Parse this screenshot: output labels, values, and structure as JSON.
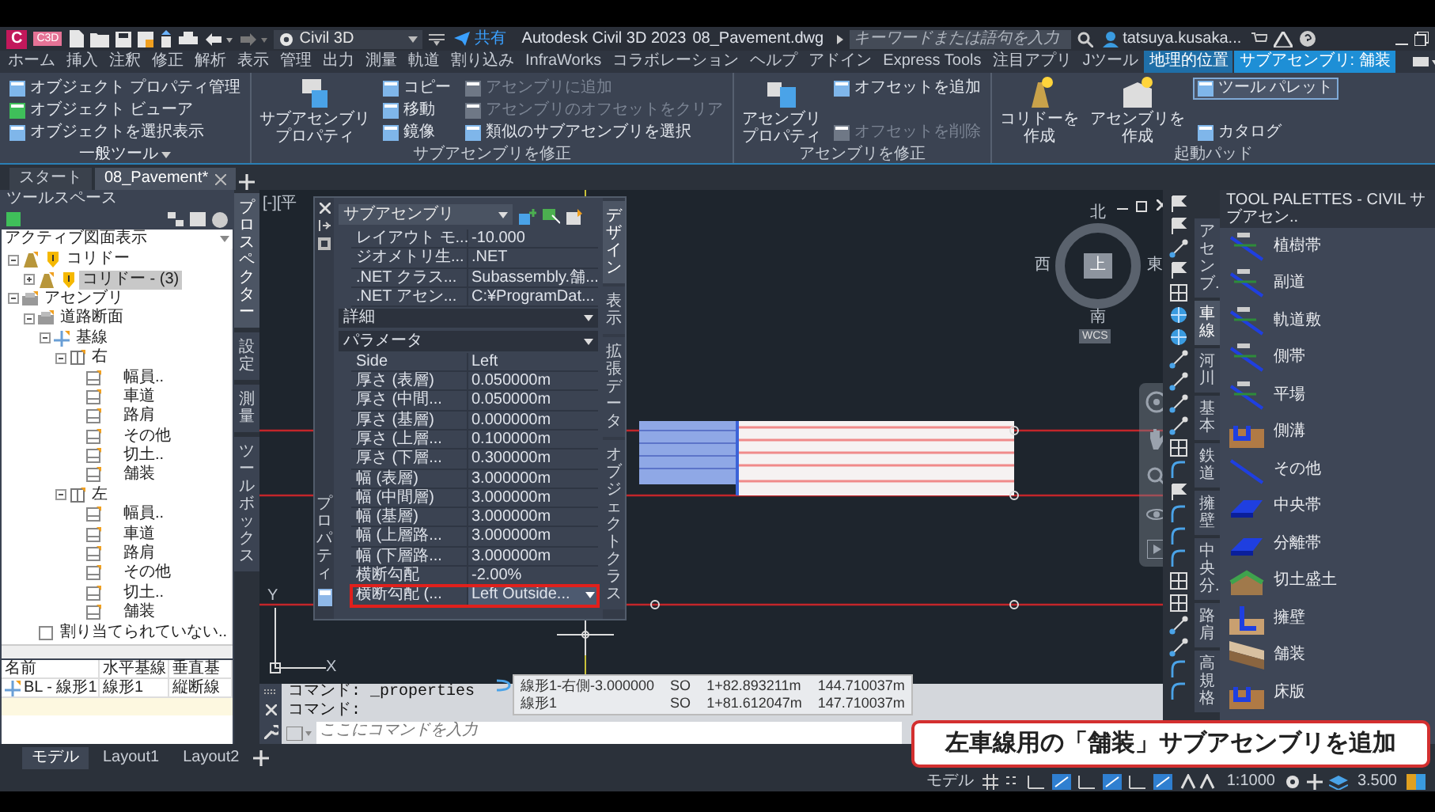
{
  "title_bar": {
    "logo": "C",
    "badge": "C3D",
    "workspace": "Civil 3D",
    "share": "共有",
    "app_title": "Autodesk Civil 3D 2023",
    "file_name": "08_Pavement.dwg",
    "search": {
      "placeholder": "キーワードまたは語句を入力"
    },
    "user": "tatsuya.kusaka..."
  },
  "menu_tabs": [
    {
      "label": "ホーム",
      "selected": false,
      "contextual": false
    },
    {
      "label": "挿入",
      "selected": false,
      "contextual": false
    },
    {
      "label": "注釈",
      "selected": false,
      "contextual": false
    },
    {
      "label": "修正",
      "selected": false,
      "contextual": false
    },
    {
      "label": "解析",
      "selected": false,
      "contextual": false
    },
    {
      "label": "表示",
      "selected": false,
      "contextual": false
    },
    {
      "label": "管理",
      "selected": false,
      "contextual": false
    },
    {
      "label": "出力",
      "selected": false,
      "contextual": false
    },
    {
      "label": "測量",
      "selected": false,
      "contextual": false
    },
    {
      "label": "軌道",
      "selected": false,
      "contextual": false
    },
    {
      "label": "割り込み",
      "selected": false,
      "contextual": false
    },
    {
      "label": "InfraWorks",
      "selected": false,
      "contextual": false
    },
    {
      "label": "コラボレーション",
      "selected": false,
      "contextual": false
    },
    {
      "label": "ヘルプ",
      "selected": false,
      "contextual": false
    },
    {
      "label": "アドイン",
      "selected": false,
      "contextual": false
    },
    {
      "label": "Express Tools",
      "selected": false,
      "contextual": false
    },
    {
      "label": "注目アプリ",
      "selected": false,
      "contextual": false
    },
    {
      "label": "Jツール",
      "selected": false,
      "contextual": false
    },
    {
      "label": "地理的位置",
      "selected": false,
      "contextual": true
    },
    {
      "label": "サブアセンブリ: 舗装",
      "selected": true,
      "contextual": true
    }
  ],
  "ribbon": [
    {
      "title": "一般ツール",
      "has_menu": true,
      "columns": [
        [
          {
            "label": "オブジェクト プロパティ管理",
            "disabled": false,
            "active": false
          },
          {
            "label": "オブジェクト ビューア",
            "disabled": false,
            "active": false
          },
          {
            "label": "オブジェクトを選択表示",
            "disabled": false,
            "active": false
          }
        ]
      ]
    },
    {
      "title": "サブアセンブリを修正",
      "has_menu": false,
      "large_buttons": [
        {
          "lines": [
            "サブアセンブリ",
            "プロパティ"
          ]
        }
      ],
      "columns": [
        [
          {
            "label": "コピー",
            "disabled": false,
            "active": false
          },
          {
            "label": "移動",
            "disabled": false,
            "active": false
          },
          {
            "label": "鏡像",
            "disabled": false,
            "active": false
          }
        ],
        [
          {
            "label": "アセンブリに追加",
            "disabled": true,
            "active": false
          },
          {
            "label": "アセンブリのオフセットをクリア",
            "disabled": true,
            "active": false
          },
          {
            "label": "類似のサブアセンブリを選択",
            "disabled": false,
            "active": false
          }
        ]
      ]
    },
    {
      "title": "アセンブリを修正",
      "has_menu": false,
      "large_buttons": [
        {
          "lines": [
            "アセンブリ",
            "プロパティ"
          ]
        }
      ],
      "columns": [
        [
          {
            "label": "オフセットを追加",
            "disabled": false,
            "active": false
          },
          {
            "label": "オフセットを削除",
            "disabled": true,
            "active": false
          }
        ]
      ]
    },
    {
      "title": "起動パッド",
      "has_menu": false,
      "large_buttons": [
        {
          "lines": [
            "コリドーを",
            "作成"
          ]
        },
        {
          "lines": [
            "アセンブリを",
            "作成"
          ]
        }
      ],
      "columns": [
        [
          {
            "label": "ツール パレット",
            "disabled": false,
            "active": true
          },
          {
            "label": "カタログ",
            "disabled": false,
            "active": false
          }
        ]
      ]
    }
  ],
  "doc_tabs": [
    {
      "label": "スタート",
      "selected": false
    },
    {
      "label": "08_Pavement*",
      "selected": true
    }
  ],
  "toolspace": {
    "title": "ツールスペース",
    "view": "アクティブ図面表示",
    "tree": [
      {
        "label": "コリドー",
        "kind": "corridor",
        "warning": true,
        "expanded": true,
        "selected": false,
        "children": [
          {
            "label": "コリドー - (3)",
            "kind": "corridor",
            "warning": true,
            "expanded": false,
            "selected": true
          }
        ]
      },
      {
        "label": "アセンブリ",
        "kind": "folder",
        "warning": false,
        "expanded": true,
        "selected": false,
        "children": [
          {
            "label": "道路断面",
            "kind": "assembly",
            "warning": false,
            "expanded": true,
            "selected": false,
            "children": [
              {
                "label": "基線",
                "kind": "baseline",
                "warning": false,
                "expanded": true,
                "selected": false,
                "children": [
                  {
                    "label": "右",
                    "kind": "group",
                    "warning": false,
                    "expanded": true,
                    "selected": false,
                    "children": [
                      {
                        "label": "幅員..",
                        "kind": "subassembly",
                        "warning": false,
                        "selected": false
                      },
                      {
                        "label": "車道",
                        "kind": "subassembly",
                        "warning": false,
                        "selected": false
                      },
                      {
                        "label": "路肩",
                        "kind": "subassembly",
                        "warning": false,
                        "selected": false
                      },
                      {
                        "label": "その他",
                        "kind": "subassembly",
                        "warning": false,
                        "selected": false
                      },
                      {
                        "label": "切土..",
                        "kind": "subassembly",
                        "warning": false,
                        "selected": false
                      },
                      {
                        "label": "舗装",
                        "kind": "subassembly",
                        "warning": false,
                        "selected": false
                      }
                    ]
                  },
                  {
                    "label": "左",
                    "kind": "group",
                    "warning": false,
                    "expanded": true,
                    "selected": false,
                    "children": [
                      {
                        "label": "幅員..",
                        "kind": "subassembly",
                        "warning": false,
                        "selected": false
                      },
                      {
                        "label": "車道",
                        "kind": "subassembly",
                        "warning": false,
                        "selected": false
                      },
                      {
                        "label": "路肩",
                        "kind": "subassembly",
                        "warning": false,
                        "selected": false
                      },
                      {
                        "label": "その他",
                        "kind": "subassembly",
                        "warning": false,
                        "selected": false
                      },
                      {
                        "label": "切土..",
                        "kind": "subassembly",
                        "warning": false,
                        "selected": false
                      },
                      {
                        "label": "舗装",
                        "kind": "subassembly",
                        "warning": false,
                        "selected": false
                      }
                    ]
                  }
                ]
              }
            ]
          },
          {
            "label": "割り当てられていない..",
            "kind": "unassigned",
            "warning": false,
            "selected": false
          }
        ]
      }
    ],
    "table": {
      "columns": [
        "名前",
        "水平基線",
        "垂直基"
      ],
      "rows": [
        [
          "BL - 線形1",
          "線形1",
          "縦断線"
        ]
      ]
    },
    "side_tabs": [
      {
        "label": "プロスペクター",
        "selected": true
      },
      {
        "label": "設定",
        "selected": false
      },
      {
        "label": "測量",
        "selected": false
      },
      {
        "label": "ツールボックス",
        "selected": false
      }
    ]
  },
  "viewport": {
    "label": "[-][平",
    "viewcube": {
      "north": "北",
      "west": "西",
      "top": "上",
      "east": "東",
      "south": "南",
      "ucs": "WCS"
    },
    "ucs_axes": {
      "x": "X",
      "y": "Y"
    }
  },
  "properties": {
    "title": "プロパティ",
    "dropdown": "サブアセンブリ",
    "side_tabs": [
      {
        "label": "デザイン",
        "selected": true
      },
      {
        "label": "表示",
        "selected": false
      },
      {
        "label": "拡張データ",
        "selected": false
      },
      {
        "label": "オブジェクトクラス",
        "selected": false
      }
    ],
    "rows": [
      {
        "kind": "row",
        "key": "レイアウト モ...",
        "value": "-10.000",
        "selected": false
      },
      {
        "kind": "row",
        "key": "ジオメトリ生...",
        "value": ".NET",
        "selected": false
      },
      {
        "kind": "row",
        "key": ".NET クラス...",
        "value": "Subassembly.舗...",
        "selected": false
      },
      {
        "kind": "row",
        "key": ".NET アセン...",
        "value": "C:¥ProgramDat...",
        "selected": false
      },
      {
        "kind": "section",
        "label": "詳細"
      },
      {
        "kind": "section",
        "label": "パラメータ"
      },
      {
        "kind": "row",
        "key": "Side",
        "value": "Left",
        "selected": false
      },
      {
        "kind": "row",
        "key": "厚さ (表層)",
        "value": "0.050000m",
        "selected": false
      },
      {
        "kind": "row",
        "key": "厚さ (中間...",
        "value": "0.050000m",
        "selected": false
      },
      {
        "kind": "row",
        "key": "厚さ (基層)",
        "value": "0.000000m",
        "selected": false
      },
      {
        "kind": "row",
        "key": "厚さ (上層...",
        "value": "0.100000m",
        "selected": false
      },
      {
        "kind": "row",
        "key": "厚さ (下層...",
        "value": "0.300000m",
        "selected": false
      },
      {
        "kind": "row",
        "key": "幅 (表層)",
        "value": "3.000000m",
        "selected": false
      },
      {
        "kind": "row",
        "key": "幅 (中間層)",
        "value": "3.000000m",
        "selected": false
      },
      {
        "kind": "row",
        "key": "幅 (基層)",
        "value": "3.000000m",
        "selected": false
      },
      {
        "kind": "row",
        "key": "幅 (上層路...",
        "value": "3.000000m",
        "selected": false
      },
      {
        "kind": "row",
        "key": "幅 (下層路...",
        "value": "3.000000m",
        "selected": false
      },
      {
        "kind": "row",
        "key": "横断勾配",
        "value": "-2.00%",
        "selected": false
      },
      {
        "kind": "dropdown",
        "key": "横断勾配 (...",
        "value": "Left Outside...",
        "selected": true
      }
    ]
  },
  "snap_tooltip": [
    [
      "線形1-右側-3.000000",
      "SO",
      "1+82.893211m",
      "144.710037m"
    ],
    [
      "線形1",
      "SO",
      "1+81.612047m",
      "147.710037m"
    ]
  ],
  "command_line": {
    "history": [
      "コマンド:  _properties",
      "コマンド:"
    ],
    "placeholder": "ここにコマンドを入力"
  },
  "tool_palette": {
    "title": "TOOL PALETTES - CIVIL サブアセン..",
    "tabs": [
      {
        "label": "アセンブ..",
        "selected": false
      },
      {
        "label": "車線",
        "selected": true
      },
      {
        "label": "河川",
        "selected": false
      },
      {
        "label": "基本",
        "selected": false
      },
      {
        "label": "鉄道",
        "selected": false
      },
      {
        "label": "擁壁",
        "selected": false
      },
      {
        "label": "中央分..",
        "selected": false
      },
      {
        "label": "路肩",
        "selected": false
      },
      {
        "label": "高規格",
        "selected": false
      }
    ],
    "items": [
      "植樹帯",
      "副道",
      "軌道敷",
      "側帯",
      "平場",
      "側溝",
      "その他",
      "中央帯",
      "分離帯",
      "切土盛土",
      "擁壁",
      "舗装",
      "床版"
    ]
  },
  "layout_tabs": [
    {
      "label": "モデル",
      "selected": true
    },
    {
      "label": "Layout1",
      "selected": false
    },
    {
      "label": "Layout2",
      "selected": false
    }
  ],
  "status_bar": {
    "space": "モデル",
    "scale": "1:1000",
    "value": "3.500"
  },
  "caption": "左車線用の「舗装」サブアセンブリを追加"
}
